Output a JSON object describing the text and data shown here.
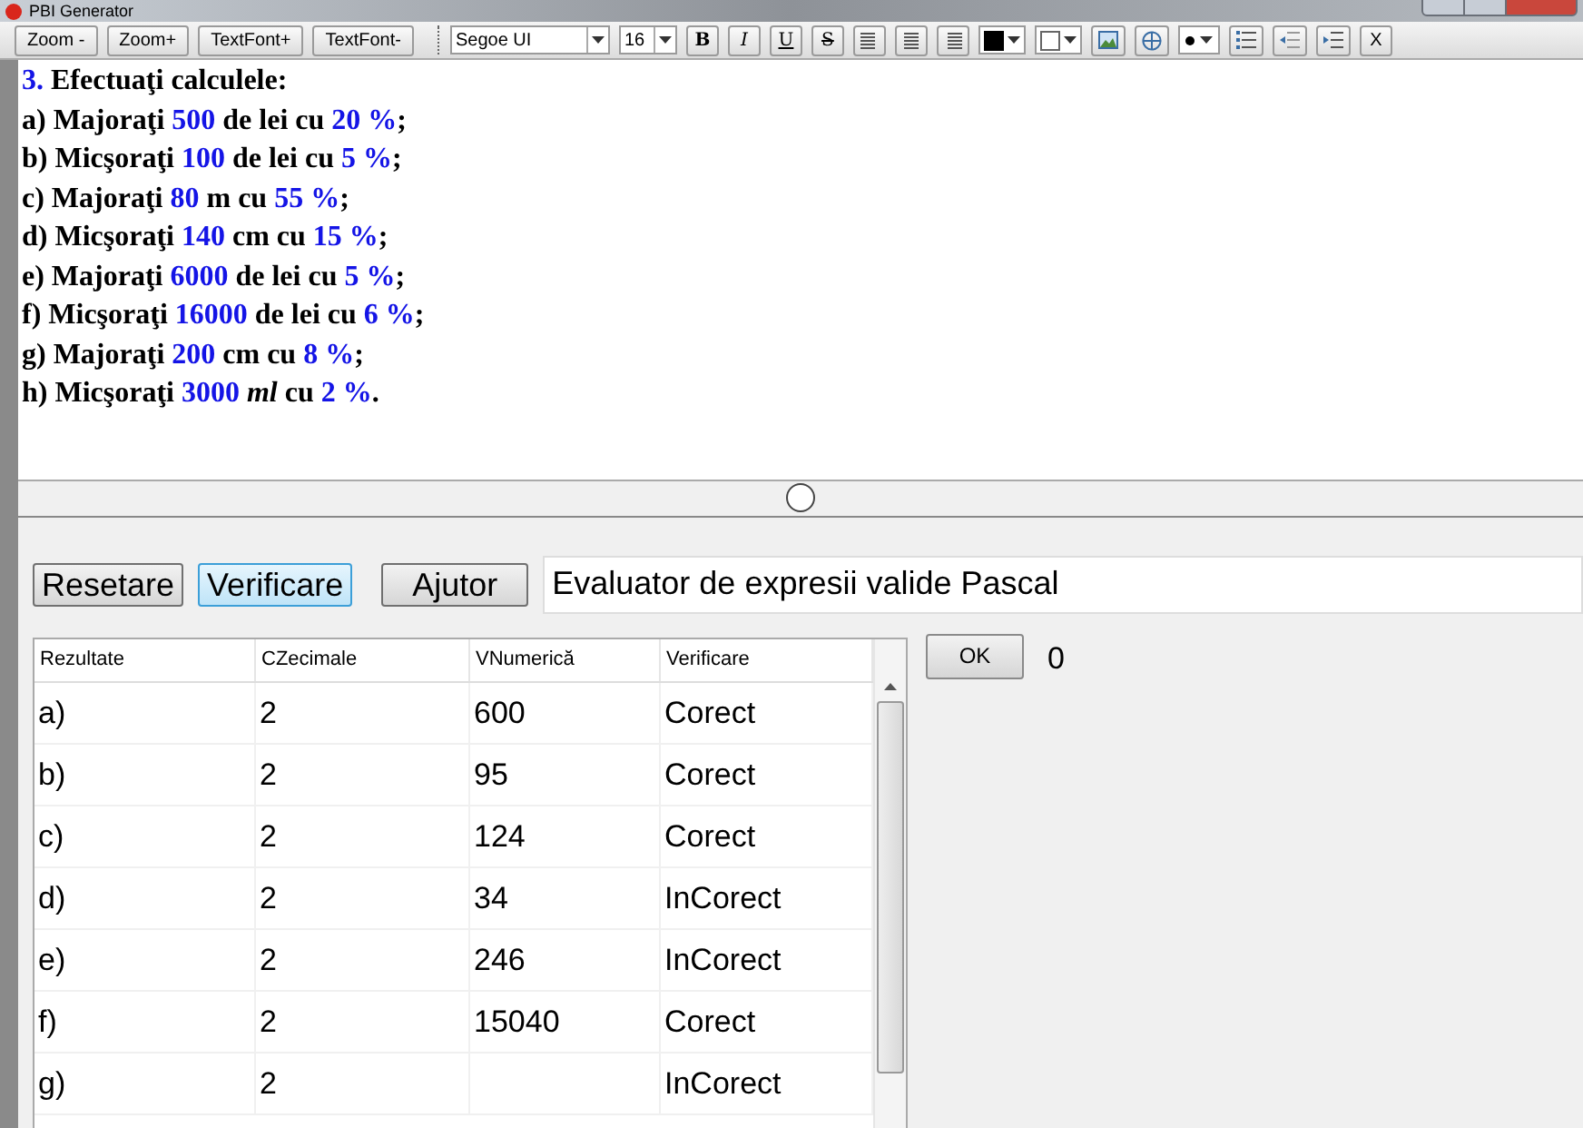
{
  "window": {
    "title": "PBI Generator"
  },
  "toolbar": {
    "buttons": [
      "Zoom -",
      "Zoom+",
      "TextFont+",
      "TextFont-"
    ],
    "font": "Segoe UI",
    "size": "16",
    "format_buttons": [
      {
        "label": "B",
        "kind": "bold"
      },
      {
        "label": "I",
        "kind": "italic"
      },
      {
        "label": "U",
        "kind": "underline"
      },
      {
        "label": "S",
        "kind": "strike"
      }
    ],
    "overflow": "X"
  },
  "problem": {
    "lines": [
      [
        {
          "text": "3.",
          "kind": "value"
        },
        {
          "text": " Efectuaţi calculele:",
          "kind": "plain"
        }
      ],
      [
        {
          "text": "a) Majoraţi ",
          "kind": "plain"
        },
        {
          "text": "500",
          "kind": "value"
        },
        {
          "text": " de lei cu ",
          "kind": "plain"
        },
        {
          "text": "20 %",
          "kind": "value"
        },
        {
          "text": ";",
          "kind": "plain"
        }
      ],
      [
        {
          "text": "b) Micşoraţi ",
          "kind": "plain"
        },
        {
          "text": "100",
          "kind": "value"
        },
        {
          "text": " de lei cu ",
          "kind": "plain"
        },
        {
          "text": "5 %",
          "kind": "value"
        },
        {
          "text": ";",
          "kind": "plain"
        }
      ],
      [
        {
          "text": "c) Majoraţi ",
          "kind": "plain"
        },
        {
          "text": "80",
          "kind": "value"
        },
        {
          "text": " m cu ",
          "kind": "plain"
        },
        {
          "text": "55 %",
          "kind": "value"
        },
        {
          "text": ";",
          "kind": "plain"
        }
      ],
      [
        {
          "text": "d) Micşoraţi ",
          "kind": "plain"
        },
        {
          "text": "140",
          "kind": "value"
        },
        {
          "text": " cm cu ",
          "kind": "plain"
        },
        {
          "text": "15 %",
          "kind": "value"
        },
        {
          "text": ";",
          "kind": "plain"
        }
      ],
      [
        {
          "text": "e) Majoraţi ",
          "kind": "plain"
        },
        {
          "text": "6000",
          "kind": "value"
        },
        {
          "text": " de lei cu ",
          "kind": "plain"
        },
        {
          "text": "5 %",
          "kind": "value"
        },
        {
          "text": ";",
          "kind": "plain"
        }
      ],
      [
        {
          "text": "f) Micşoraţi ",
          "kind": "plain"
        },
        {
          "text": "16000",
          "kind": "value"
        },
        {
          "text": " de lei cu ",
          "kind": "plain"
        },
        {
          "text": "6 %",
          "kind": "value"
        },
        {
          "text": ";",
          "kind": "plain"
        }
      ],
      [
        {
          "text": "g) Majoraţi ",
          "kind": "plain"
        },
        {
          "text": "200",
          "kind": "value"
        },
        {
          "text": " cm cu ",
          "kind": "plain"
        },
        {
          "text": "8 %",
          "kind": "value"
        },
        {
          "text": ";",
          "kind": "plain"
        }
      ],
      [
        {
          "text": "h) Micşoraţi ",
          "kind": "plain"
        },
        {
          "text": "3000 ",
          "kind": "value"
        },
        {
          "text": "ml",
          "kind": "unit"
        },
        {
          "text": " cu ",
          "kind": "plain"
        },
        {
          "text": "2 %",
          "kind": "value"
        },
        {
          "text": ".",
          "kind": "plain"
        }
      ]
    ]
  },
  "actions": [
    {
      "label": "Resetare",
      "selected": false
    },
    {
      "label": "Verificare",
      "selected": true
    },
    {
      "label": "Ajutor",
      "selected": false
    }
  ],
  "expression_field": {
    "value": "Evaluator de expresii valide Pascal"
  },
  "table": {
    "columns": [
      "Rezultate",
      "CZecimale",
      "VNumerică",
      "Verificare"
    ],
    "rows": [
      [
        "a)",
        "2",
        "600",
        "Corect"
      ],
      [
        "b)",
        "2",
        "95",
        "Corect"
      ],
      [
        "c)",
        "2",
        "124",
        "Corect"
      ],
      [
        "d)",
        "2",
        "34",
        "InCorect"
      ],
      [
        "e)",
        "2",
        "246",
        "InCorect"
      ],
      [
        "f)",
        "2",
        "15040",
        "Corect"
      ],
      [
        "g)",
        "2",
        "",
        "InCorect"
      ]
    ]
  },
  "ok_button": "OK",
  "score": "0"
}
